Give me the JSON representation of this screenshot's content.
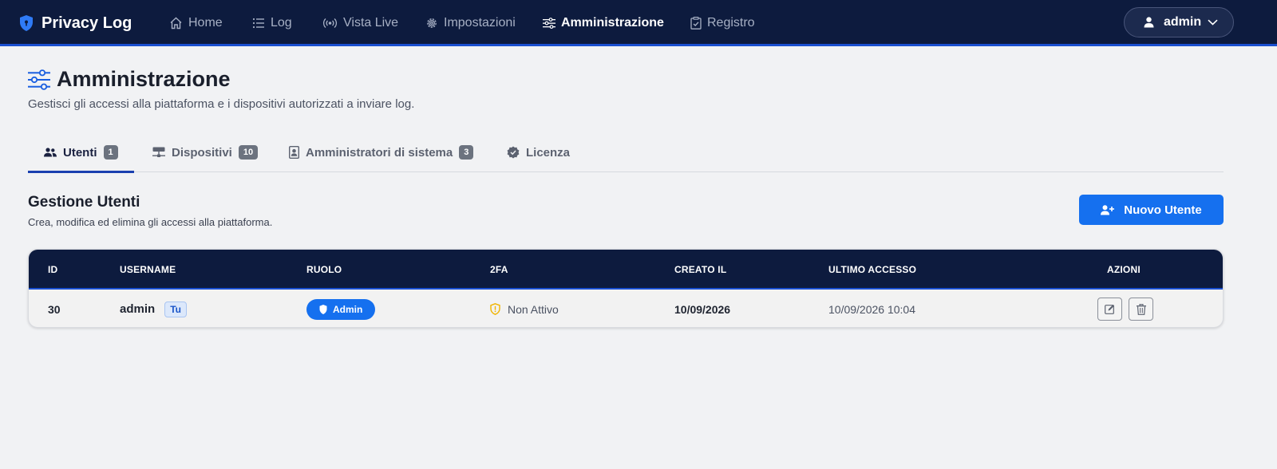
{
  "navbar": {
    "brand": "Privacy Log",
    "items": [
      {
        "label": "Home",
        "icon": "home-icon"
      },
      {
        "label": "Log",
        "icon": "list-icon"
      },
      {
        "label": "Vista Live",
        "icon": "broadcast-icon"
      },
      {
        "label": "Impostazioni",
        "icon": "gear-icon"
      },
      {
        "label": "Amministrazione",
        "icon": "sliders-icon",
        "active": true
      },
      {
        "label": "Registro",
        "icon": "clipboard-check-icon"
      }
    ],
    "user": "admin"
  },
  "page": {
    "title": "Amministrazione",
    "subtitle": "Gestisci gli accessi alla piattaforma e i dispositivi autorizzati a inviare log."
  },
  "tabs": [
    {
      "label": "Utenti",
      "count": "1",
      "icon": "users-icon",
      "active": true
    },
    {
      "label": "Dispositivi",
      "count": "10",
      "icon": "hdd-network-icon"
    },
    {
      "label": "Amministratori di sistema",
      "count": "3",
      "icon": "person-badge-icon"
    },
    {
      "label": "Licenza",
      "icon": "patch-check-icon"
    }
  ],
  "section": {
    "title": "Gestione Utenti",
    "subtitle": "Crea, modifica ed elimina gli accessi alla piattaforma.",
    "new_user_label": "Nuovo Utente"
  },
  "table": {
    "headers": [
      "ID",
      "USERNAME",
      "RUOLO",
      "2FA",
      "CREATO IL",
      "ULTIMO ACCESSO",
      "AZIONI"
    ],
    "rows": [
      {
        "id": "30",
        "username": "admin",
        "self_badge": "Tu",
        "role": "Admin",
        "twofa": "Non Attivo",
        "created": "10/09/2026",
        "last_access": "10/09/2026 10:04"
      }
    ]
  },
  "colors": {
    "navbar_bg": "#0d1b3e",
    "accent": "#1570ef",
    "warning": "#f0b400"
  }
}
